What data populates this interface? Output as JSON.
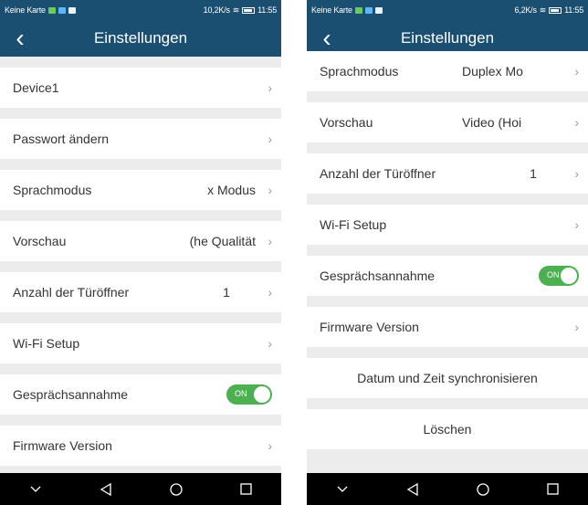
{
  "left": {
    "status": {
      "carrier": "Keine Karte",
      "speed": "10,2K/s",
      "time": "11:55"
    },
    "header": {
      "title": "Einstellungen"
    },
    "rows": [
      {
        "label": "Device1"
      },
      {
        "label": "Passwort ändern"
      },
      {
        "label": "Sprachmodus",
        "value": "x Modus"
      },
      {
        "label": "Vorschau",
        "value": "he Qualität)"
      },
      {
        "label": "Anzahl der Türöffner",
        "value": "1"
      },
      {
        "label": "Wi-Fi Setup"
      },
      {
        "label": "Gesprächsannahme",
        "toggle": "ON"
      },
      {
        "label": "Firmware Version"
      }
    ]
  },
  "right": {
    "status": {
      "carrier": "Keine Karte",
      "speed": "6,2K/s",
      "time": "11:55"
    },
    "header": {
      "title": "Einstellungen"
    },
    "rows": [
      {
        "label": "Sprachmodus",
        "value": "Duplex Mo"
      },
      {
        "label": "Vorschau",
        "value": "Video (Hoi"
      },
      {
        "label": "Anzahl der Türöffner",
        "value": "1"
      },
      {
        "label": "Wi-Fi Setup"
      },
      {
        "label": "Gesprächsannahme",
        "toggle": "ON"
      },
      {
        "label": "Firmware Version"
      },
      {
        "label": "Datum und Zeit synchronisieren"
      },
      {
        "label": "Löschen"
      }
    ]
  },
  "icons": {
    "back": "chevron-left-icon",
    "chevron": "chevron-right-icon",
    "nav": [
      "hide-keyboard-icon",
      "back-triangle-icon",
      "home-circle-icon",
      "recents-square-icon"
    ]
  },
  "colors": {
    "header": "#1b4f72",
    "toggle_on": "#4caf50",
    "background": "#ececec",
    "navbar": "#000000"
  }
}
